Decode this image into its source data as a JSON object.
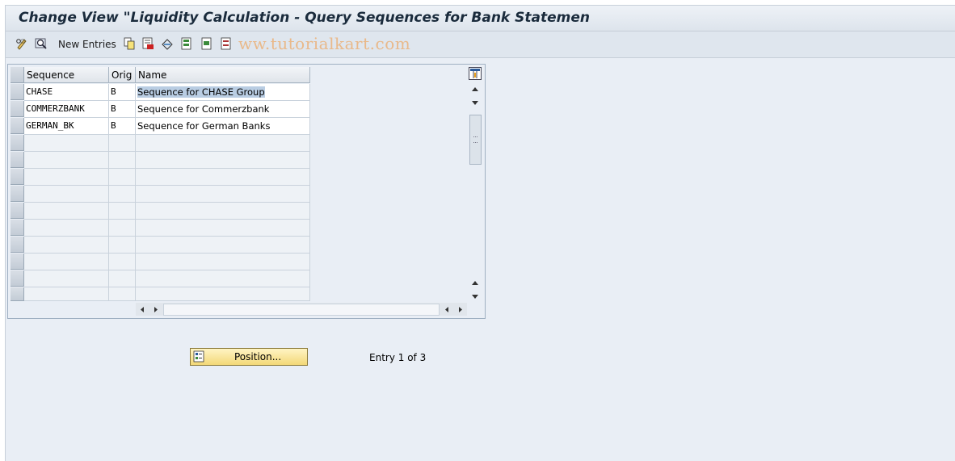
{
  "window": {
    "title": "Change View \"Liquidity Calculation - Query Sequences for Bank Statemen"
  },
  "toolbar": {
    "new_entries_label": "New Entries",
    "watermark": "ww.tutorialkart.com",
    "icons": [
      "display-change-icon",
      "find-icon",
      "copy-icon",
      "delete-icon",
      "undo-icon",
      "select-all-icon",
      "select-block-icon",
      "deselect-all-icon"
    ]
  },
  "table": {
    "columns": [
      "Sequence",
      "Orig",
      "Name"
    ],
    "rows": [
      {
        "sequence": "CHASE",
        "orig": "B",
        "name": "Sequence for CHASE Group"
      },
      {
        "sequence": "COMMERZBANK",
        "orig": "B",
        "name": "Sequence for Commerzbank"
      },
      {
        "sequence": "GERMAN_BK",
        "orig": "B",
        "name": "Sequence for German Banks"
      }
    ],
    "empty_rows": 10,
    "column_settings_icon": "table-settings-icon"
  },
  "footer": {
    "position_button_label": "Position...",
    "entry_text": "Entry 1 of 3"
  },
  "colors": {
    "accent_button": "#f3d877",
    "selection": "#b9cde3",
    "background": "#e9eef5"
  }
}
